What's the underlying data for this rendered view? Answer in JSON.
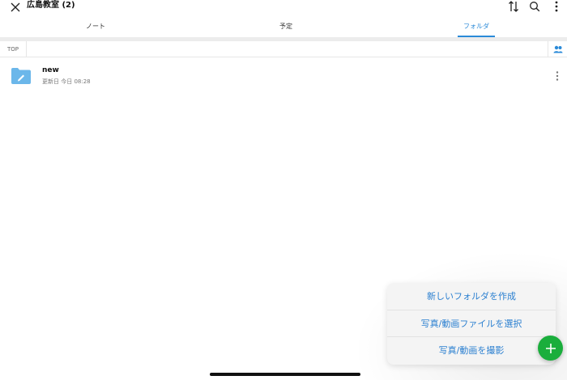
{
  "header": {
    "title": "広島教室 (2)"
  },
  "tabs": [
    {
      "label": "ノート"
    },
    {
      "label": "予定"
    },
    {
      "label": "フォルダ"
    }
  ],
  "breadcrumb": {
    "top_label": "TOP"
  },
  "folders": [
    {
      "name": "new",
      "meta": "更新日 今日 08:28"
    }
  ],
  "menu": {
    "items": [
      {
        "label": "新しいフォルダを作成"
      },
      {
        "label": "写真/動画ファイルを選択"
      },
      {
        "label": "写真/動画を撮影"
      }
    ]
  },
  "colors": {
    "accent": "#2a8ad8",
    "fab": "#1aae3c",
    "folder": "#6bb7ea"
  },
  "active_tab": "フォルダ"
}
